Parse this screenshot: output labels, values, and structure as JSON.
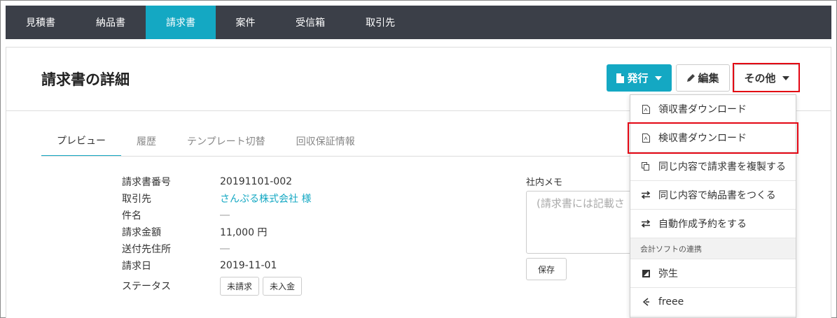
{
  "nav": {
    "tabs": [
      {
        "label": "見積書"
      },
      {
        "label": "納品書"
      },
      {
        "label": "請求書"
      },
      {
        "label": "案件"
      },
      {
        "label": "受信箱"
      },
      {
        "label": "取引先"
      }
    ],
    "active_tab": "請求書"
  },
  "header": {
    "title": "請求書の詳細",
    "issue_label": "発行",
    "edit_label": "編集",
    "other_label": "その他"
  },
  "tabs": [
    {
      "label": "プレビュー"
    },
    {
      "label": "履歴"
    },
    {
      "label": "テンプレート切替"
    },
    {
      "label": "回収保証情報"
    }
  ],
  "details": {
    "invoice_number": {
      "label": "請求書番号",
      "value": "20191101-002"
    },
    "client": {
      "label": "取引先",
      "value": "さんぷる株式会社 様"
    },
    "subject": {
      "label": "件名",
      "value": "―"
    },
    "amount": {
      "label": "請求金額",
      "value": "11,000 円"
    },
    "address": {
      "label": "送付先住所",
      "value": "―"
    },
    "date": {
      "label": "請求日",
      "value": "2019-11-01"
    },
    "status": {
      "label": "ステータス",
      "badges": [
        "未請求",
        "未入金"
      ]
    }
  },
  "memo": {
    "label": "社内メモ",
    "placeholder": "(請求書には記載さ",
    "save_label": "保存"
  },
  "dropdown": {
    "items": [
      {
        "label": "領収書ダウンロード",
        "icon": "pdf-icon"
      },
      {
        "label": "検収書ダウンロード",
        "icon": "pdf-icon"
      },
      {
        "label": "同じ内容で請求書を複製する",
        "icon": "copy-icon"
      },
      {
        "label": "同じ内容で納品書をつくる",
        "icon": "exchange-icon"
      },
      {
        "label": "自動作成予約をする",
        "icon": "exchange-icon"
      }
    ],
    "section_label": "会計ソフトの連携",
    "integrations": [
      {
        "label": "弥生",
        "icon": "yayoi-icon"
      },
      {
        "label": "freee",
        "icon": "freee-icon"
      }
    ]
  },
  "colors": {
    "nav_bg": "#3b3f48",
    "accent": "#14a8c3",
    "highlight": "#e30613"
  }
}
